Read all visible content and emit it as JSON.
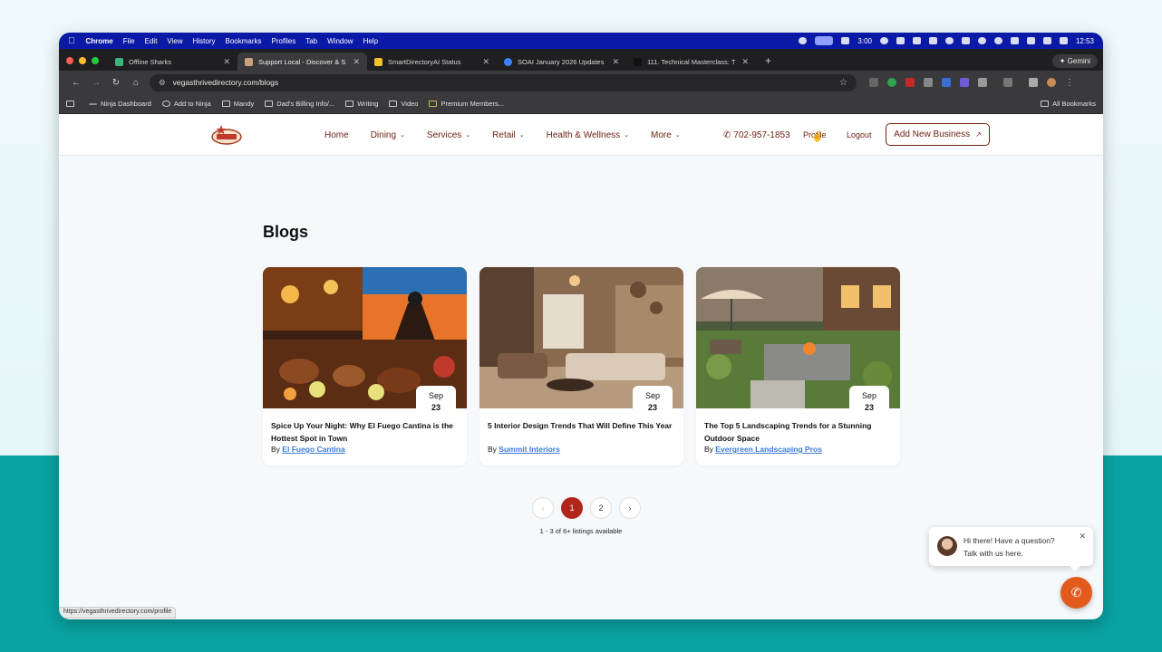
{
  "menubar": {
    "app": "Chrome",
    "items": [
      "File",
      "Edit",
      "View",
      "History",
      "Bookmarks",
      "Profiles",
      "Tab",
      "Window",
      "Help"
    ],
    "timer": "3:00",
    "clock": "12:53"
  },
  "tabs": [
    {
      "title": "Offline Sharks",
      "color": "#3fb37f"
    },
    {
      "title": "Support Local - Discover & S",
      "color": "#c9a27a"
    },
    {
      "title": "SmartDirectoryAI Status",
      "color": "#f2c12e"
    },
    {
      "title": "SOAI January 2026 Updates",
      "color": "#3b82f6"
    },
    {
      "title": "111. Technical Masterclass: T",
      "color": "#222222"
    }
  ],
  "browser": {
    "url": "vegasthrivedirectory.com/blogs",
    "gemini": "Gemini"
  },
  "bookmarks": [
    "Ninja Dashboard",
    "Add to Ninja",
    "Mandy",
    "Dad's Billing Info/...",
    "Writing",
    "Video",
    "Premium Members..."
  ],
  "bookmarks_all": "All Bookmarks",
  "site": {
    "nav": [
      {
        "label": "Home",
        "dropdown": false
      },
      {
        "label": "Dining",
        "dropdown": true
      },
      {
        "label": "Services",
        "dropdown": true
      },
      {
        "label": "Retail",
        "dropdown": true
      },
      {
        "label": "Health & Wellness",
        "dropdown": true
      },
      {
        "label": "More",
        "dropdown": true
      }
    ],
    "phone": "702-957-1853",
    "profile": "Profile",
    "logout": "Logout",
    "add_business": "Add New Business"
  },
  "page": {
    "title": "Blogs",
    "cards": [
      {
        "month": "Sep",
        "day": "23",
        "title": "Spice Up Your Night: Why El Fuego Cantina is the Hottest Spot in Town",
        "by": "By",
        "author": "El Fuego Cantina"
      },
      {
        "month": "Sep",
        "day": "23",
        "title": "5 Interior Design Trends That Will Define This Year",
        "by": "By",
        "author": "Summit Interiors"
      },
      {
        "month": "Sep",
        "day": "23",
        "title": "The Top 5 Landscaping Trends for a Stunning Outdoor Space",
        "by": "By",
        "author": "Evergreen Landscaping Pros"
      }
    ],
    "pagination": {
      "prev": "‹",
      "pages": [
        "1",
        "2"
      ],
      "next": "›",
      "current": "1"
    },
    "listings": "1 - 3 of 6+ listings available"
  },
  "status_url": "https://vegasthrivedirectory.com/profile",
  "chat": {
    "line1": "Hi there! Have a question?",
    "line2": "Talk with us here."
  },
  "colors": {
    "accent": "#6d2414",
    "active_page": "#b0261b",
    "call": "#e25a1c",
    "teal": "#0aa3a3"
  }
}
